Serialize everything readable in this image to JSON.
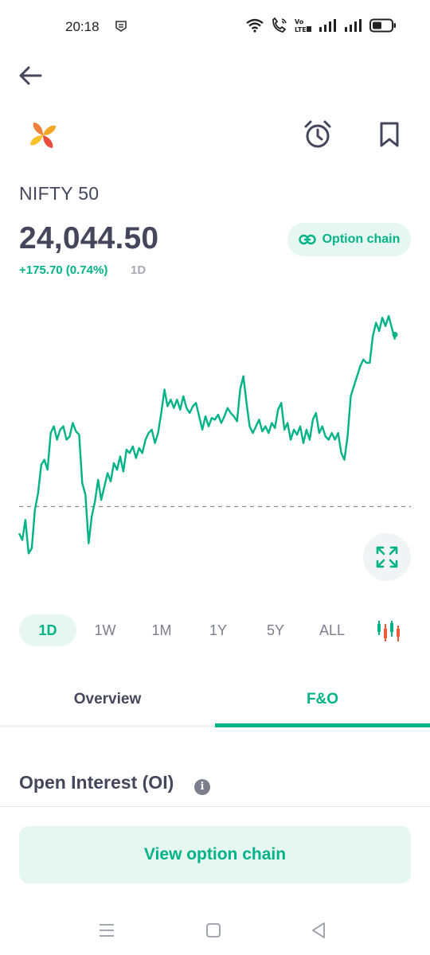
{
  "status_bar": {
    "time": "20:18",
    "icons": [
      "shield-icon",
      "wifi-icon",
      "wifi-calling-icon",
      "volte-icon",
      "signal-icon",
      "signal-icon",
      "battery-icon"
    ]
  },
  "header": {
    "back_icon": "arrow-left-icon",
    "logo_icon": "nifty-logo",
    "alarm_icon": "alarm-clock-icon",
    "bookmark_icon": "bookmark-icon"
  },
  "quote": {
    "name": "NIFTY 50",
    "price": "24,044.50",
    "change": "+175.70 (0.74%)",
    "period": "1D"
  },
  "option_chain_pill": {
    "label": "Option chain",
    "icon": "link-icon"
  },
  "chart_data": {
    "type": "line",
    "series": [
      {
        "values": [
          0.14,
          0.1,
          0.22,
          0.02,
          0.05,
          0.28,
          0.38,
          0.55,
          0.58,
          0.52,
          0.74,
          0.78,
          0.7,
          0.76,
          0.78,
          0.7,
          0.72,
          0.8,
          0.75,
          0.73,
          0.44,
          0.37,
          0.08,
          0.24,
          0.33,
          0.46,
          0.34,
          0.42,
          0.5,
          0.45,
          0.56,
          0.52,
          0.6,
          0.51,
          0.64,
          0.62,
          0.66,
          0.59,
          0.65,
          0.62,
          0.7,
          0.74,
          0.76,
          0.68,
          0.74,
          0.86,
          1.0,
          0.9,
          0.94,
          0.89,
          0.94,
          0.88,
          0.96,
          0.89,
          0.86,
          0.9,
          0.92,
          0.84,
          0.76,
          0.84,
          0.78,
          0.83,
          0.82,
          0.85,
          0.8,
          0.84,
          0.89,
          0.86,
          0.84,
          0.81,
          1.0,
          1.08,
          0.92,
          0.78,
          0.74,
          0.78,
          0.82,
          0.75,
          0.78,
          0.74,
          0.8,
          0.77,
          0.88,
          0.92,
          0.76,
          0.8,
          0.7,
          0.76,
          0.73,
          0.78,
          0.68,
          0.76,
          0.7,
          0.82,
          0.86,
          0.74,
          0.78,
          0.72,
          0.7,
          0.74,
          0.7,
          0.74,
          0.62,
          0.58,
          0.72,
          0.96,
          1.02,
          1.08,
          1.14,
          1.18,
          1.16,
          1.16,
          1.32,
          1.4,
          1.35,
          1.43,
          1.38,
          1.44,
          1.37,
          1.3
        ]
      }
    ],
    "reference_line": 0.3,
    "ylim": [
      -0.05,
      1.45
    ],
    "grid": false
  },
  "expand_icon": "expand-icon",
  "range_tabs": {
    "items": [
      "1D",
      "1W",
      "1M",
      "1Y",
      "5Y",
      "ALL"
    ],
    "active": "1D",
    "candle_icon": "candlestick-icon"
  },
  "tabs": {
    "overview": "Overview",
    "fno": "F&O",
    "active": "F&O"
  },
  "open_interest": {
    "title": "Open Interest (OI)",
    "info_icon": "info-icon",
    "info_glyph": "i"
  },
  "cta": {
    "label": "View option chain"
  },
  "nav_bar": {
    "icons": [
      "menu-icon",
      "home-square-icon",
      "back-triangle-icon"
    ]
  },
  "colors": {
    "accent": "#00b386",
    "accent_bg": "#e6f7f2",
    "text": "#44475b",
    "muted": "#7c7e8c",
    "candle_up": "#00b386",
    "candle_down": "#eb5b3c"
  }
}
